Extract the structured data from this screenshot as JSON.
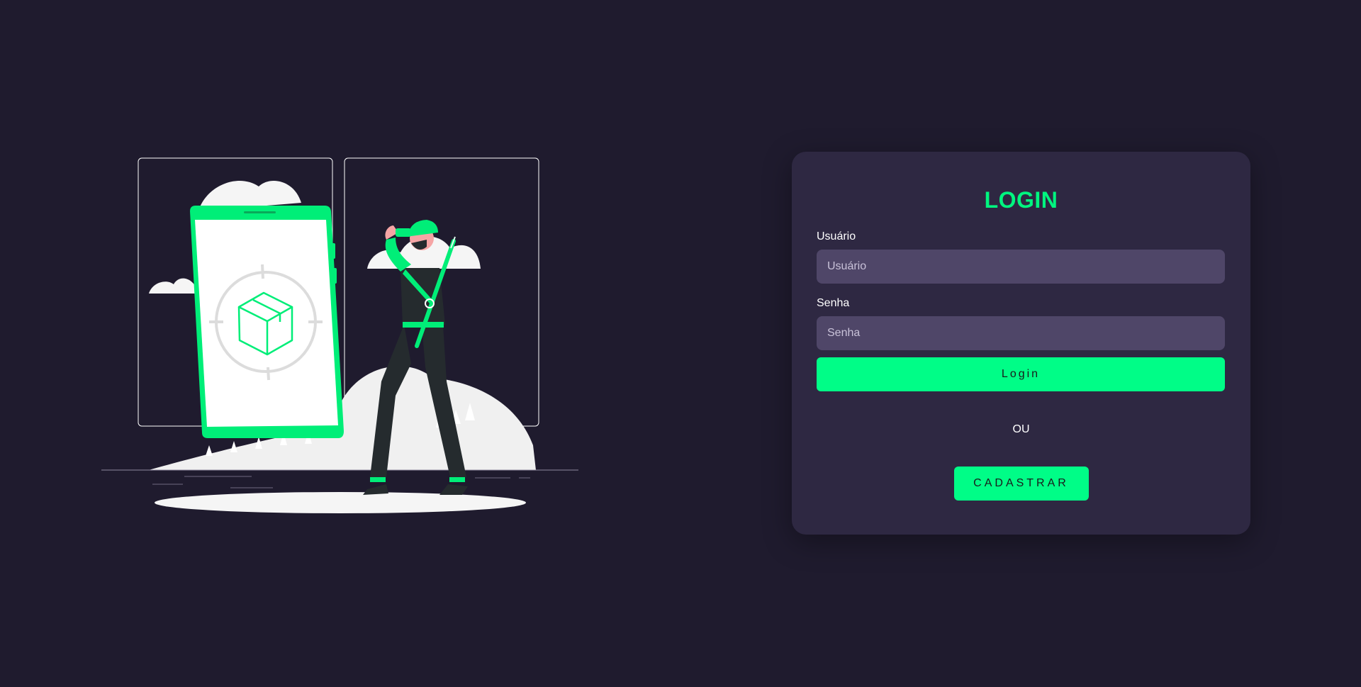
{
  "colors": {
    "background": "#1f1b2e",
    "card": "#2e2842",
    "input": "#4f4668",
    "accent": "#00fd87",
    "title": "#00f57f"
  },
  "illustration": {
    "name": "hunter-with-binoculars-phone-target-illustration"
  },
  "login_form": {
    "title": "LOGIN",
    "username_label": "Usuário",
    "username_placeholder": "Usuário",
    "username_value": "",
    "password_label": "Senha",
    "password_placeholder": "Senha",
    "password_value": "",
    "login_button": "Login",
    "or_text": "OU",
    "register_button": "CADASTRAR"
  }
}
